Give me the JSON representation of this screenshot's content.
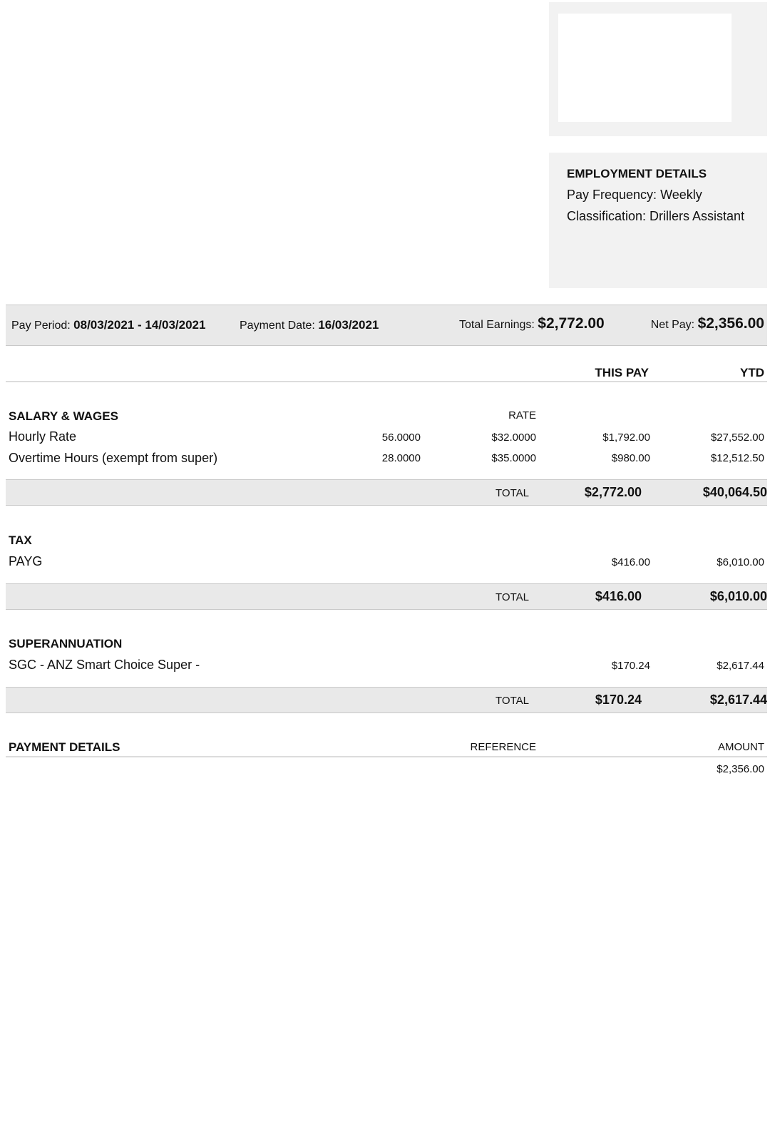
{
  "employment": {
    "title": "EMPLOYMENT DETAILS",
    "pay_frequency": "Pay Frequency: Weekly",
    "classification": "Classification: Drillers Assistant"
  },
  "summary": {
    "pay_period_label": "Pay Period:",
    "pay_period_value": "08/03/2021 - 14/03/2021",
    "payment_date_label": "Payment Date:",
    "payment_date_value": "16/03/2021",
    "total_earnings_label": "Total Earnings:",
    "total_earnings_value": "$2,772.00",
    "net_pay_label": "Net Pay:",
    "net_pay_value": "$2,356.00"
  },
  "columns": {
    "this_pay": "THIS PAY",
    "ytd": "YTD"
  },
  "salary": {
    "heading": "SALARY & WAGES",
    "rate_header": "RATE",
    "rows": [
      {
        "label": "Hourly Rate",
        "qty": "56.0000",
        "rate": "$32.0000",
        "this_pay": "$1,792.00",
        "ytd": "$27,552.00"
      },
      {
        "label": "Overtime Hours (exempt from super)",
        "qty": "28.0000",
        "rate": "$35.0000",
        "this_pay": "$980.00",
        "ytd": "$12,512.50"
      }
    ],
    "total_label": "TOTAL",
    "total_this_pay": "$2,772.00",
    "total_ytd": "$40,064.50"
  },
  "tax": {
    "heading": "TAX",
    "rows": [
      {
        "label": "PAYG",
        "this_pay": "$416.00",
        "ytd": "$6,010.00"
      }
    ],
    "total_label": "TOTAL",
    "total_this_pay": "$416.00",
    "total_ytd": "$6,010.00"
  },
  "super": {
    "heading": "SUPERANNUATION",
    "rows": [
      {
        "label": "SGC - ANZ Smart Choice Super -",
        "this_pay": "$170.24",
        "ytd": "$2,617.44"
      }
    ],
    "total_label": "TOTAL",
    "total_this_pay": "$170.24",
    "total_ytd": "$2,617.44"
  },
  "payment": {
    "heading": "PAYMENT DETAILS",
    "reference_header": "REFERENCE",
    "amount_header": "AMOUNT",
    "rows": [
      {
        "reference": "",
        "amount": "$2,356.00"
      }
    ]
  }
}
